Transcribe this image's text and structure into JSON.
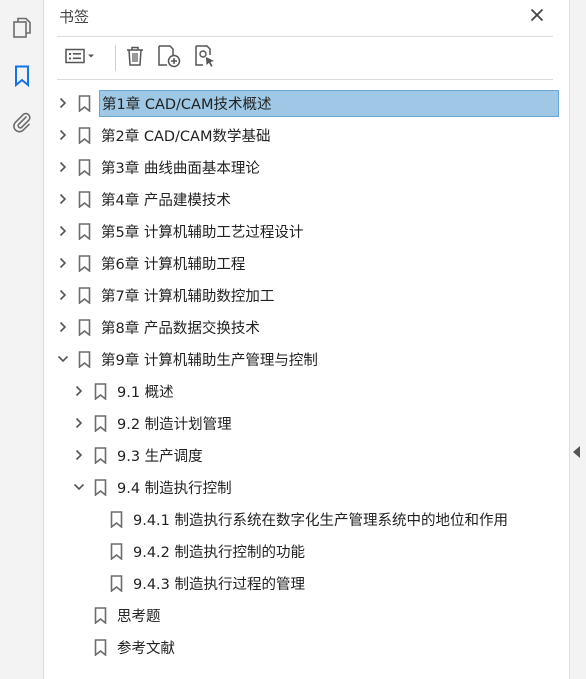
{
  "panel": {
    "title": "书签"
  },
  "icons": {
    "rail": [
      "pages-icon",
      "bookmark-icon",
      "attachment-icon"
    ],
    "toolbar": [
      "options-icon",
      "delete-icon",
      "new-bookmark-icon",
      "new-bookmark-from-structure-icon"
    ]
  },
  "colors": {
    "selection": "#9ec8e6",
    "accent": "#1473e6",
    "icon": "#6d6d6d"
  },
  "bookmarks": [
    {
      "label": "第1章 CAD/CAM技术概述",
      "level": 0,
      "expanded": false,
      "selected": true
    },
    {
      "label": "第2章 CAD/CAM数学基础",
      "level": 0,
      "expanded": false
    },
    {
      "label": "第3章 曲线曲面基本理论",
      "level": 0,
      "expanded": false
    },
    {
      "label": "第4章 产品建模技术",
      "level": 0,
      "expanded": false
    },
    {
      "label": "第5章 计算机辅助工艺过程设计",
      "level": 0,
      "expanded": false
    },
    {
      "label": "第6章 计算机辅助工程",
      "level": 0,
      "expanded": false
    },
    {
      "label": "第7章 计算机辅助数控加工",
      "level": 0,
      "expanded": false
    },
    {
      "label": "第8章 产品数据交换技术",
      "level": 0,
      "expanded": false
    },
    {
      "label": "第9章 计算机辅助生产管理与控制",
      "level": 0,
      "expanded": true
    },
    {
      "label": "9.1 概述",
      "level": 1,
      "expanded": false
    },
    {
      "label": "9.2 制造计划管理",
      "level": 1,
      "expanded": false
    },
    {
      "label": "9.3 生产调度",
      "level": 1,
      "expanded": false
    },
    {
      "label": "9.4 制造执行控制",
      "level": 1,
      "expanded": true
    },
    {
      "label": "9.4.1 制造执行系统在数字化生产管理系统中的地位和作用",
      "level": 2,
      "leaf": true
    },
    {
      "label": "9.4.2 制造执行控制的功能",
      "level": 2,
      "leaf": true
    },
    {
      "label": "9.4.3 制造执行过程的管理",
      "level": 2,
      "leaf": true
    },
    {
      "label": "思考题",
      "level": 1,
      "leaf": true
    },
    {
      "label": "参考文献",
      "level": 1,
      "leaf": true
    }
  ]
}
